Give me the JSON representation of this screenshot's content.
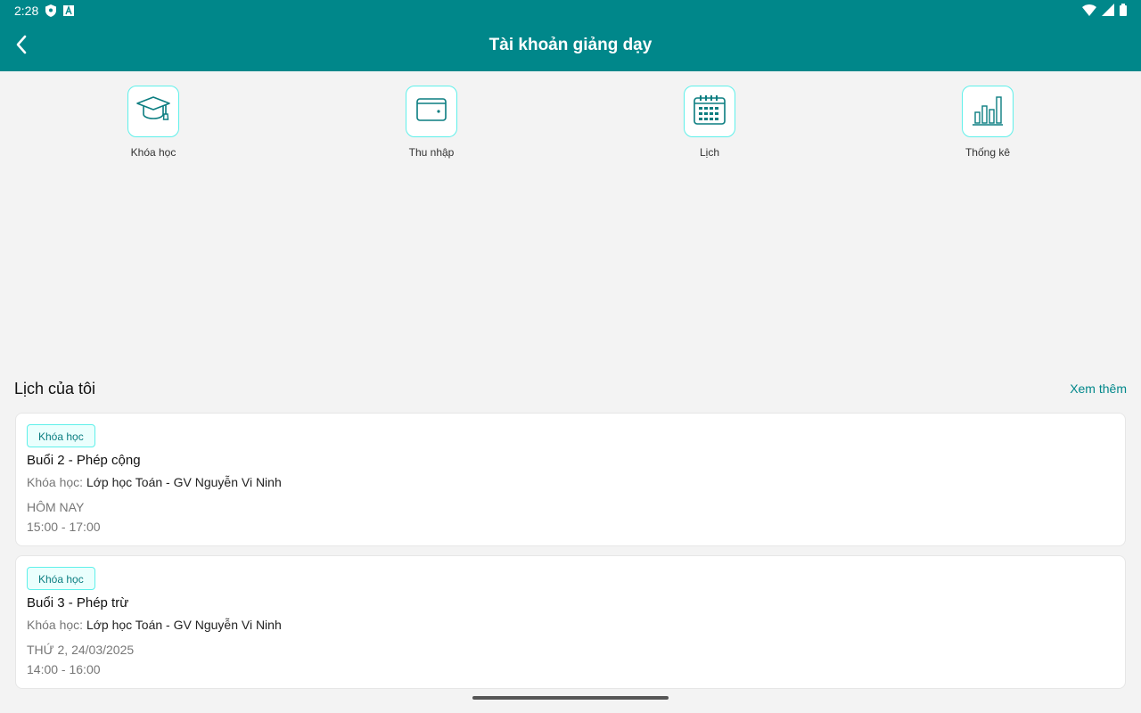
{
  "status_bar": {
    "time": "2:28",
    "icons": [
      "shield-icon",
      "a-box-icon",
      "wifi-icon",
      "signal-icon",
      "battery-icon"
    ]
  },
  "app_bar": {
    "title": "Tài khoản giảng dạy",
    "back_icon": "back-arrow-icon"
  },
  "quick_actions": [
    {
      "label": "Khóa học",
      "icon": "graduation-cap-icon"
    },
    {
      "label": "Thu nhập",
      "icon": "wallet-icon"
    },
    {
      "label": "Lịch",
      "icon": "calendar-icon"
    },
    {
      "label": "Thống kê",
      "icon": "bar-chart-icon"
    }
  ],
  "schedule": {
    "title": "Lịch của tôi",
    "see_more": "Xem thêm",
    "items": [
      {
        "tag": "Khóa học",
        "title": "Buổi 2 - Phép cộng",
        "course_label": "Khóa học:",
        "course_name": "Lớp học Toán - GV Nguyễn Vi Ninh",
        "day": "HÔM NAY",
        "time": "15:00 - 17:00"
      },
      {
        "tag": "Khóa học",
        "title": "Buổi 3 - Phép trừ",
        "course_label": "Khóa học:",
        "course_name": "Lớp học Toán - GV Nguyễn Vi Ninh",
        "day": "THỨ 2, 24/03/2025",
        "time": "14:00 - 16:00"
      }
    ]
  },
  "colors": {
    "primary": "#00878a",
    "accent_border": "#5ff0ea",
    "background": "#f3f3f3"
  }
}
